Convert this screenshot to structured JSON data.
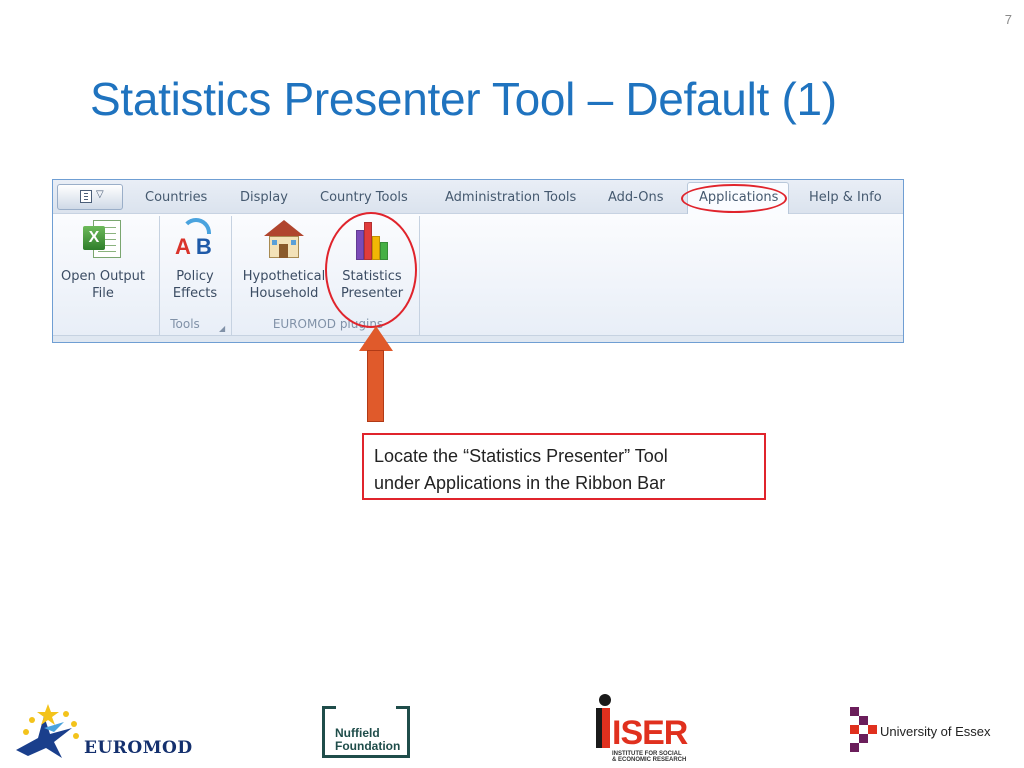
{
  "page_number": "7",
  "slide_title": "Statistics Presenter Tool – Default (1)",
  "ribbon": {
    "tabs": [
      "Countries",
      "Display",
      "Country Tools",
      "Administration Tools",
      "Add-Ons",
      "Applications",
      "Help & Info"
    ],
    "active_tab": "Applications",
    "buttons": {
      "open_output_file": {
        "line1": "Open Output",
        "line2": "File"
      },
      "policy_effects": {
        "line1": "Policy",
        "line2": "Effects"
      },
      "hypothetical_household": {
        "line1": "Hypothetical",
        "line2": "Household"
      },
      "statistics_presenter": {
        "line1": "Statistics",
        "line2": "Presenter"
      }
    },
    "groups": {
      "tools": "Tools",
      "plugins": "EUROMOD plugins"
    },
    "icons": [
      "excel-icon",
      "ab-compare-icon",
      "house-icon",
      "bar-chart-icon"
    ]
  },
  "callout": {
    "line1": "Locate the “Statistics Presenter” Tool",
    "line2": "under Applications in the Ribbon Bar"
  },
  "highlight_color": "#e0242c",
  "title_color": "#1f73bf",
  "logos": {
    "euromod": "EUROMOD",
    "nuffield_line1": "Nuffield",
    "nuffield_line2": "Foundation",
    "iser_word": "ISER",
    "iser_sub1": "INSTITUTE FOR SOCIAL",
    "iser_sub2": "& ECONOMIC RESEARCH",
    "essex": "University of Essex"
  }
}
